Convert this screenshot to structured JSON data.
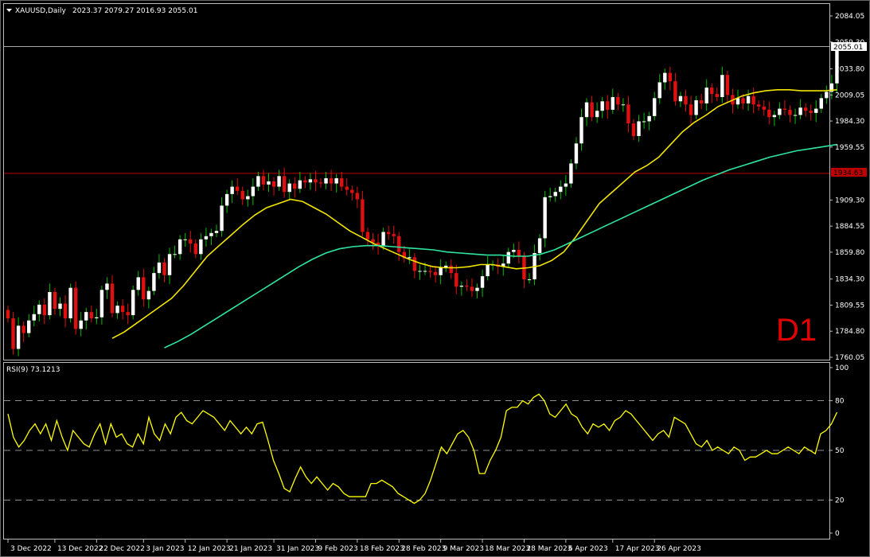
{
  "header": {
    "title": "XAUUSD,Daily",
    "ohlc": "2023.37 2079.27 2016.93 2055.01"
  },
  "timeframe_label": "D1",
  "price_tag": "2055.01",
  "level_tag": "1934.63",
  "rsi_label": "RSI(9) 73.1213",
  "colors": {
    "background": "#000000",
    "bull": "#ffffff",
    "bear": "#e01010",
    "wick_bull": "#00c000",
    "ma_fast": "#f2e600",
    "ma_slow": "#2ee6a0",
    "rsi": "#ffff00",
    "level_line": "#c00000",
    "price_line": "#c0c0c0"
  },
  "chart_data": [
    {
      "type": "candlestick",
      "title": "XAUUSD,Daily",
      "ylim": [
        1760.05,
        2084.05
      ],
      "y_ticks": [
        "2084.05",
        "2059.30",
        "2033.80",
        "2009.05",
        "1984.30",
        "1959.55",
        "1934.63",
        "1909.30",
        "1884.55",
        "1859.80",
        "1834.30",
        "1809.55",
        "1784.80",
        "1760.05"
      ],
      "x_ticks": [
        "3 Dec 2022",
        "13 Dec 2022",
        "22 Dec 2022",
        "3 Jan 2023",
        "12 Jan 2023",
        "21 Jan 2023",
        "31 Jan 2023",
        "9 Feb 2023",
        "18 Feb 2023",
        "28 Feb 2023",
        "9 Mar 2023",
        "18 Mar 2023",
        "28 Mar 2023",
        "6 Apr 2023",
        "17 Apr 2023",
        "26 Apr 2023"
      ],
      "x_tick_index": [
        0,
        9,
        17,
        26,
        34,
        42,
        51,
        59,
        67,
        75,
        83,
        91,
        99,
        107,
        116,
        124
      ],
      "horizontal_lines": [
        1934.63,
        2055.01
      ],
      "close": [
        1797,
        1768,
        1790,
        1783,
        1795,
        1801,
        1810,
        1800,
        1822,
        1806,
        1811,
        1797,
        1826,
        1787,
        1795,
        1803,
        1797,
        1798,
        1824,
        1830,
        1802,
        1809,
        1803,
        1800,
        1824,
        1836,
        1815,
        1823,
        1840,
        1850,
        1838,
        1858,
        1858,
        1872,
        1872,
        1868,
        1858,
        1872,
        1875,
        1878,
        1880,
        1904,
        1915,
        1922,
        1918,
        1910,
        1913,
        1922,
        1932,
        1924,
        1927,
        1922,
        1932,
        1917,
        1925,
        1920,
        1928,
        1926,
        1929,
        1926,
        1925,
        1930,
        1925,
        1930,
        1922,
        1919,
        1916,
        1910,
        1879,
        1872,
        1869,
        1866,
        1879,
        1877,
        1875,
        1860,
        1854,
        1855,
        1842,
        1842,
        1842,
        1841,
        1838,
        1845,
        1847,
        1840,
        1827,
        1828,
        1827,
        1823,
        1826,
        1837,
        1848,
        1848,
        1846,
        1849,
        1860,
        1862,
        1856,
        1834,
        1834,
        1859,
        1873,
        1912,
        1913,
        1917,
        1922,
        1925,
        1944,
        1963,
        1988,
        2002,
        1988,
        1994,
        2003,
        1995,
        2007,
        2000,
        2000,
        1982,
        1970,
        1984,
        1984,
        1989,
        2006,
        2021,
        2030,
        2022,
        2003,
        2008,
        2000,
        1990,
        2004,
        2001,
        2016,
        2010,
        2007,
        2028,
        2009,
        2000,
        2006,
        2001,
        2008,
        2000,
        1998,
        1995,
        1988,
        1990,
        1996,
        1995,
        1990,
        1990,
        1997,
        1994,
        1992,
        1996,
        2006,
        2012,
        2020,
        2055
      ],
      "series": [
        {
          "name": "MA fast",
          "start_index": 20,
          "values": [
            1778,
            1784,
            1792,
            1800,
            1808,
            1816,
            1828,
            1842,
            1856,
            1866,
            1876,
            1886,
            1895,
            1902,
            1906,
            1910,
            1908,
            1902,
            1896,
            1888,
            1880,
            1874,
            1868,
            1863,
            1858,
            1853,
            1849,
            1846,
            1845,
            1845,
            1846,
            1848,
            1848,
            1846,
            1844,
            1845,
            1847,
            1852,
            1860,
            1874,
            1890,
            1906,
            1916,
            1926,
            1936,
            1942,
            1950,
            1962,
            1974,
            1983,
            1990,
            1998,
            2003,
            2008,
            2011,
            2013,
            2014,
            2014,
            2013,
            2013,
            2013,
            2014
          ]
        },
        {
          "name": "MA slow",
          "start_index": 30,
          "values": [
            1769,
            1775,
            1782,
            1790,
            1798,
            1806,
            1814,
            1822,
            1830,
            1838,
            1846,
            1853,
            1859,
            1863,
            1865,
            1866,
            1866,
            1865,
            1864,
            1863,
            1862,
            1860,
            1859,
            1858,
            1857,
            1857,
            1856,
            1856,
            1858,
            1862,
            1868,
            1874,
            1880,
            1886,
            1892,
            1898,
            1904,
            1910,
            1916,
            1922,
            1928,
            1933,
            1938,
            1942,
            1946,
            1950,
            1953,
            1956,
            1958,
            1960,
            1962
          ]
        }
      ]
    },
    {
      "type": "line",
      "title": "RSI(9) 73.1213",
      "ylim": [
        0,
        100
      ],
      "y_ticks": [
        "100",
        "80",
        "50",
        "20",
        "0"
      ],
      "levels": [
        80,
        50,
        20
      ],
      "series": [
        {
          "name": "RSI(9)",
          "values": [
            72,
            58,
            52,
            56,
            62,
            66,
            60,
            66,
            56,
            68,
            58,
            50,
            62,
            58,
            54,
            52,
            60,
            66,
            54,
            66,
            58,
            60,
            54,
            52,
            60,
            54,
            70,
            60,
            56,
            66,
            60,
            70,
            73,
            68,
            66,
            70,
            74,
            72,
            70,
            66,
            62,
            68,
            64,
            60,
            64,
            60,
            66,
            67,
            56,
            44,
            36,
            27,
            25,
            33,
            40,
            34,
            30,
            34,
            30,
            26,
            30,
            28,
            24,
            22,
            22,
            22,
            22,
            30,
            30,
            32,
            30,
            28,
            24,
            22,
            20,
            18,
            20,
            24,
            32,
            42,
            52,
            48,
            54,
            60,
            62,
            58,
            50,
            36,
            36,
            44,
            50,
            58,
            74,
            76,
            76,
            80,
            78,
            82,
            84,
            80,
            72,
            70,
            74,
            78,
            72,
            70,
            64,
            60,
            66,
            64,
            66,
            62,
            68,
            70,
            74,
            72,
            68,
            64,
            60,
            56,
            60,
            62,
            58,
            70,
            68,
            66,
            60,
            54,
            52,
            56,
            50,
            52,
            50,
            48,
            52,
            50,
            44,
            46,
            46,
            48,
            50,
            48,
            48,
            50,
            52,
            50,
            48,
            52,
            50,
            48,
            60,
            62,
            66,
            73
          ]
        }
      ]
    }
  ]
}
